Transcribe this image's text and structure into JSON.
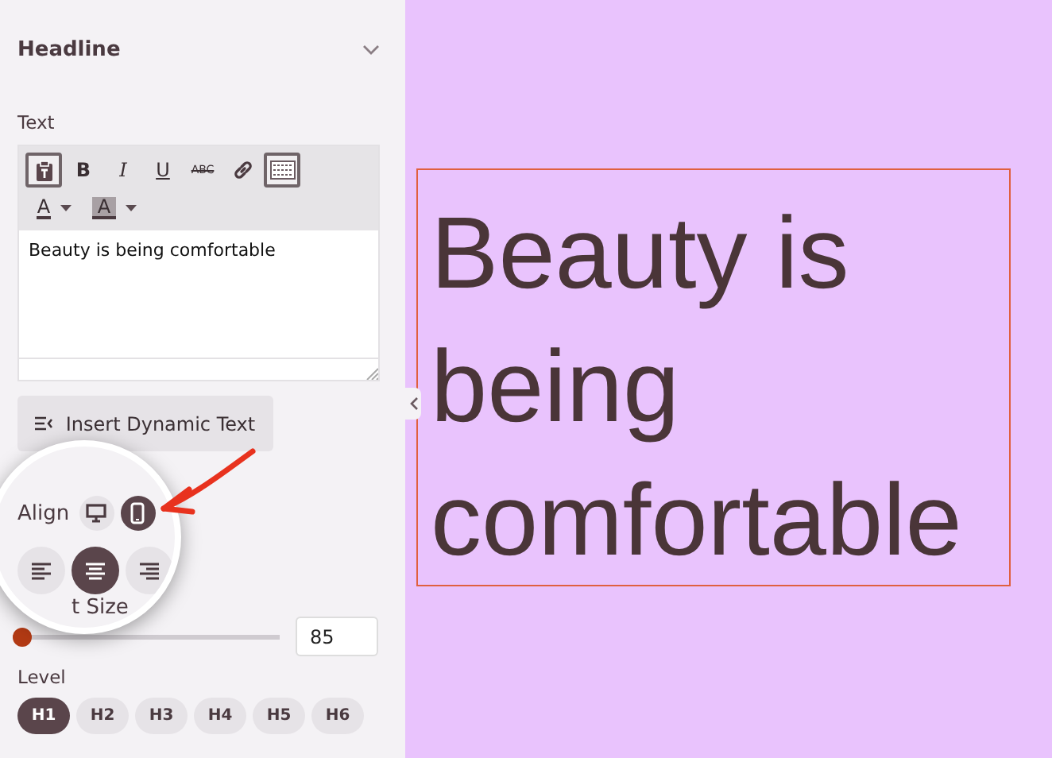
{
  "panel": {
    "title": "Headline",
    "expanded": true,
    "text_label": "Text",
    "toolbar": [
      {
        "kind": "paste",
        "on": true
      },
      {
        "kind": "bold",
        "label": "B",
        "on": false
      },
      {
        "kind": "italic",
        "label": "I",
        "on": false
      },
      {
        "kind": "underline",
        "label": "U",
        "on": false
      },
      {
        "kind": "strike",
        "label": "ABC",
        "on": false
      },
      {
        "kind": "link",
        "on": false
      },
      {
        "kind": "keyboard",
        "on": true
      },
      {
        "kind": "textcolor",
        "label": "A",
        "on": false
      },
      {
        "kind": "highlight",
        "label": "A",
        "on": false
      }
    ],
    "text_value": "Beauty is being comfortable",
    "dynamic_button": "Insert Dynamic Text",
    "magnifier": {
      "align_label": "Align",
      "devices": [
        {
          "kind": "desktop",
          "selected": false
        },
        {
          "kind": "mobile",
          "selected": true
        }
      ],
      "alignments": [
        {
          "kind": "left",
          "selected": false
        },
        {
          "kind": "center",
          "selected": true
        },
        {
          "kind": "right",
          "selected": false
        }
      ],
      "font_size_label": "t Size"
    },
    "font_size": {
      "level": 0,
      "value": "85"
    },
    "level_label": "Level",
    "levels": [
      {
        "label": "H1",
        "selected": true
      },
      {
        "label": "H2",
        "selected": false
      },
      {
        "label": "H3",
        "selected": false
      },
      {
        "label": "H4",
        "selected": false
      },
      {
        "label": "H5",
        "selected": false
      },
      {
        "label": "H6",
        "selected": false
      }
    ]
  },
  "canvas": {
    "headline": "Beauty is being comfortable"
  }
}
